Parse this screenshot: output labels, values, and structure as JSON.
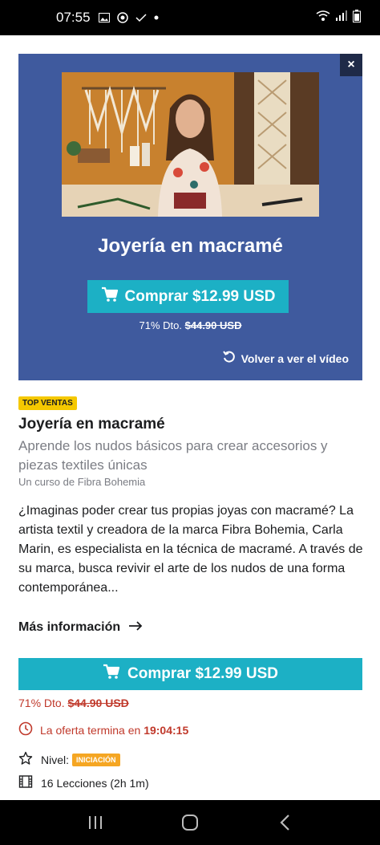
{
  "status_bar": {
    "time": "07:55"
  },
  "hero": {
    "close_label": "×",
    "title": "Joyería en macramé",
    "buy_label": "Comprar $12.99 USD",
    "discount_pct": "71% Dto.",
    "original_price": "$44.90",
    "original_currency": "USD",
    "replay_label": "Volver a ver el vídeo"
  },
  "course": {
    "badge": "TOP VENTAS",
    "title": "Joyería en macramé",
    "subtitle": "Aprende los nudos básicos para crear accesorios y piezas textiles únicas",
    "author": "Un curso de Fibra Bohemia",
    "description": "¿Imaginas poder crear tus propias joyas con macramé? La artista textil y creadora de la marca Fibra Bohemia, Carla Marin, es especialista en la técnica de macramé. A través de su marca, busca revivir el arte de los nudos de una forma contemporánea...",
    "more_info": "Más información"
  },
  "purchase": {
    "buy_label": "Comprar $12.99 USD",
    "discount_pct": "71% Dto.",
    "original_price": "$44.90",
    "original_currency": "USD",
    "offer_text": "La oferta termina en",
    "offer_time": "19:04:15"
  },
  "details": {
    "level_label": "Nivel:",
    "level_value": "INICIACIÓN",
    "lessons": "16 Lecciones (2h 1m)"
  },
  "colors": {
    "hero_bg": "#3f5a9e",
    "accent": "#1cb0c5",
    "sale_red": "#c0392b",
    "badge_yellow": "#f5c800",
    "level_orange": "#f5a623"
  },
  "icons": {
    "hero_buy": "cart-icon",
    "replay": "replay-icon",
    "more_info": "arrow-right-icon",
    "offer": "clock-icon",
    "level": "star-outline-icon",
    "lessons": "film-icon"
  }
}
